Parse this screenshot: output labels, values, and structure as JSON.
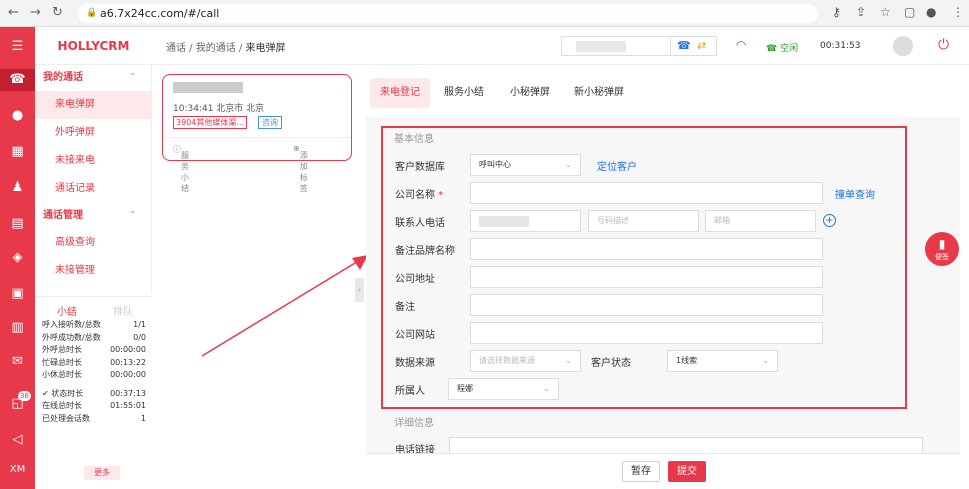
{
  "browser": {
    "url": "a6.7x24cc.com/#/call"
  },
  "brand": "HOLLYCRM",
  "rail": {
    "badge": "36",
    "bottom_label": "XM"
  },
  "sidebar": {
    "group1": "我的通话",
    "items1": [
      "来电弹屏",
      "外呼弹屏",
      "未接来电",
      "通话记录"
    ],
    "group2": "通话管理",
    "items2": [
      "高级查询",
      "未接管理"
    ]
  },
  "stats": {
    "tab_active": "小结",
    "tab_other": "排队",
    "rows": [
      {
        "label": "呼入接听数/总数",
        "value": "1/1"
      },
      {
        "label": "外呼成功数/总数",
        "value": "0/0"
      },
      {
        "label": "外呼总时长",
        "value": "00:00:00"
      },
      {
        "label": "忙碌总时长",
        "value": "00:13:22"
      },
      {
        "label": "小休总时长",
        "value": "00:00:00"
      },
      {
        "label": "状态时长",
        "value": "00:37:13"
      },
      {
        "label": "在线总时长",
        "value": "01:55:01"
      },
      {
        "label": "已处理会话数",
        "value": "1"
      }
    ],
    "more": "更多"
  },
  "topbar": {
    "crumb1": "通话",
    "crumb2": "我的通话",
    "crumb3": "来电弹屏",
    "status": "空闲",
    "timer": "00:31:53"
  },
  "callcard": {
    "time_place": "10:34:41 北京市 北京",
    "tag": "3904其他媒体渠...",
    "tag2": "咨询",
    "summary": "服务小结",
    "add_tag": "添加标签"
  },
  "tabs": [
    "来电登记",
    "服务小结",
    "小秘弹屏",
    "新小秘弹屏"
  ],
  "form": {
    "basic_title": "基本信息",
    "db_label": "客户数据库",
    "db_value": "呼叫中心",
    "locate_link": "定位客户",
    "company_label": "公司名称",
    "company_req": "*",
    "dup_link": "撞单查询",
    "phone_label": "联系人电话",
    "phone_desc_ph": "号码描述",
    "email_ph": "邮箱",
    "brand_label": "备注品牌名称",
    "address_label": "公司地址",
    "note_label": "备注",
    "website_label": "公司网站",
    "source_label": "数据来源",
    "source_ph": "请选择数据来源",
    "cust_status_label": "客户状态",
    "cust_status_value": "1线索",
    "owner_label": "所属人",
    "owner_value": "程娜",
    "detail_title": "详细信息",
    "phone_link_label": "电话链接"
  },
  "sticky": "便签",
  "footer": {
    "save": "暂存",
    "submit": "提交"
  }
}
